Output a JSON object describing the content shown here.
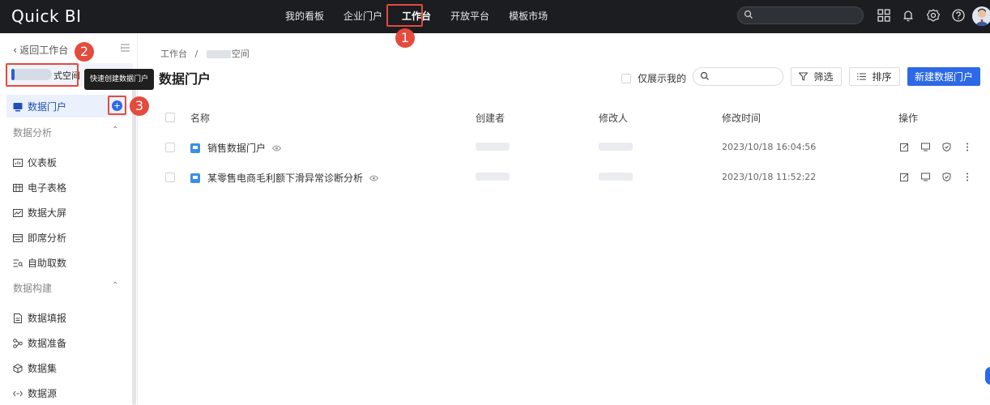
{
  "app": {
    "logo": "Quick BI"
  },
  "topnav": [
    {
      "label": "我的看板"
    },
    {
      "label": "企业门户"
    },
    {
      "label": "工作台"
    },
    {
      "label": "开放平台"
    },
    {
      "label": "模板市场"
    }
  ],
  "annotations": {
    "badge1": "1",
    "badge2": "2",
    "badge3": "3"
  },
  "sidebar": {
    "back_label": "返回工作台",
    "workspace_label": "式空间",
    "active_item": "数据门户",
    "tooltip": "快速创建数据门户",
    "group_analysis": "数据分析",
    "analysis_items": [
      "仪表板",
      "电子表格",
      "数据大屏",
      "即席分析",
      "自助取数"
    ],
    "group_build": "数据构建",
    "build_items": [
      "数据填报",
      "数据准备",
      "数据集",
      "数据源"
    ]
  },
  "main": {
    "breadcrumb_root": "工作台",
    "breadcrumb_sep": "/",
    "breadcrumb_current": "空间",
    "title": "数据门户",
    "only_mine": "仅展示我的",
    "filter_label": "筛选",
    "sort_label": "排序",
    "create_label": "新建数据门户",
    "columns": [
      "名称",
      "创建者",
      "修改人",
      "修改时间",
      "操作"
    ],
    "rows": [
      {
        "name": "销售数据门户",
        "time": "2023/10/18 16:04:56"
      },
      {
        "name": "某零售电商毛利额下滑异常诊断分析",
        "time": "2023/10/18 11:52:22"
      }
    ]
  },
  "colors": {
    "accent": "#2c69e6",
    "annotation": "#e44b3c",
    "topbar": "#1b1d21"
  }
}
